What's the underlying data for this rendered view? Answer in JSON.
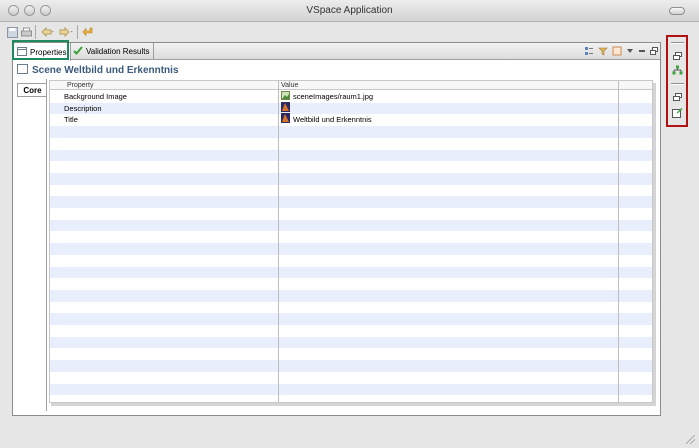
{
  "window": {
    "title": "VSpace Application"
  },
  "tabs": [
    {
      "label": "Properties",
      "icon": "properties-icon",
      "active": true
    },
    {
      "label": "Validation Results",
      "icon": "checkmark-icon",
      "active": false
    }
  ],
  "header": {
    "title": "Scene Weltbild und Erkenntnis",
    "icon": "scene-icon"
  },
  "side_tabs": [
    {
      "label": "Core"
    }
  ],
  "table": {
    "columns": [
      "Property",
      "Value"
    ],
    "rows": [
      {
        "property": "Background Image",
        "value": "sceneImages/raum1.jpg",
        "icon": "image-file-icon"
      },
      {
        "property": "Description",
        "value": "",
        "icon": "color-swatch-icon"
      },
      {
        "property": "Title",
        "value": "Weltbild und Erkenntnis",
        "icon": "color-swatch-icon"
      }
    ]
  },
  "colors": {
    "accent_header": "#3b5a7a",
    "highlight_red": "#b01212",
    "highlight_green": "#1e8a5e",
    "row_alt": "#e8eefb"
  }
}
